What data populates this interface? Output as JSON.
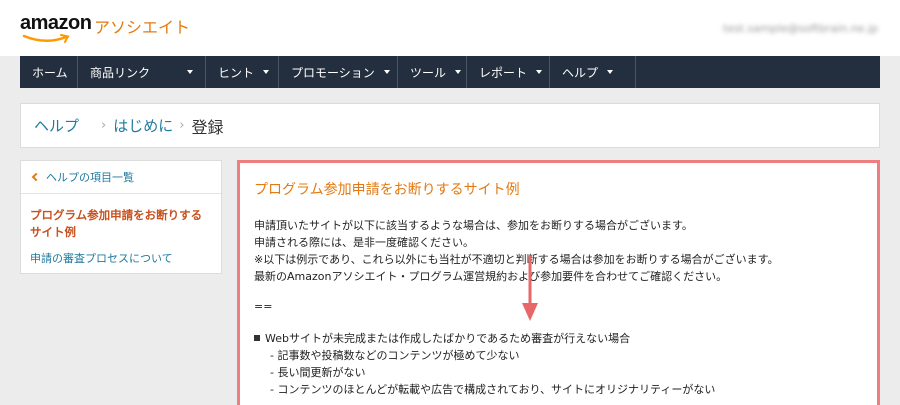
{
  "brand": {
    "logo_text": "amazon",
    "logo_sub": "アソシエイト",
    "user_email": "test.sample@softbrain.ne.jp"
  },
  "nav": {
    "items": [
      {
        "label": "ホーム",
        "has_dropdown": false
      },
      {
        "label": "商品リンク",
        "has_dropdown": true
      },
      {
        "label": "ヒント",
        "has_dropdown": true
      },
      {
        "label": "プロモーション",
        "has_dropdown": true
      },
      {
        "label": "ツール",
        "has_dropdown": true
      },
      {
        "label": "レポート",
        "has_dropdown": true
      },
      {
        "label": "ヘルプ",
        "has_dropdown": true
      }
    ]
  },
  "breadcrumb": {
    "items": [
      "ヘルプ",
      "はじめに"
    ],
    "current": "登録",
    "separator": "›"
  },
  "sidebar": {
    "back_label": "ヘルプの項目一覧",
    "active_label": "プログラム参加申請をお断りするサイト例",
    "link_label": "申請の審査プロセスについて"
  },
  "main": {
    "title": "プログラム参加申請をお断りするサイト例",
    "paragraphs": [
      "申請頂いたサイトが以下に該当するような場合は、参加をお断りする場合がございます。",
      "申請される際には、是非一度確認ください。",
      "※以下は例示であり、これら以外にも当社が不適切と判断する場合は参加をお断りする場合がございます。",
      "最新のAmazonアソシエイト・プログラム運営規約および参加要件を合わせてご確認ください。"
    ],
    "separator": "==",
    "bullet": "Webサイトが未完成または作成したばかりであるため審査が行えない場合",
    "sub_items": [
      "- 記事数や投稿数などのコンテンツが極めて少ない",
      "- 長い間更新がない",
      "- コンテンツのほとんどが転載や広告で構成されており、サイトにオリジナリティーがない"
    ]
  },
  "colors": {
    "nav_bg": "#232f3e",
    "accent_orange": "#e47911",
    "link_blue": "#1f7a9c",
    "highlight_border": "#ee7f80",
    "arrow": "#e8686a"
  }
}
